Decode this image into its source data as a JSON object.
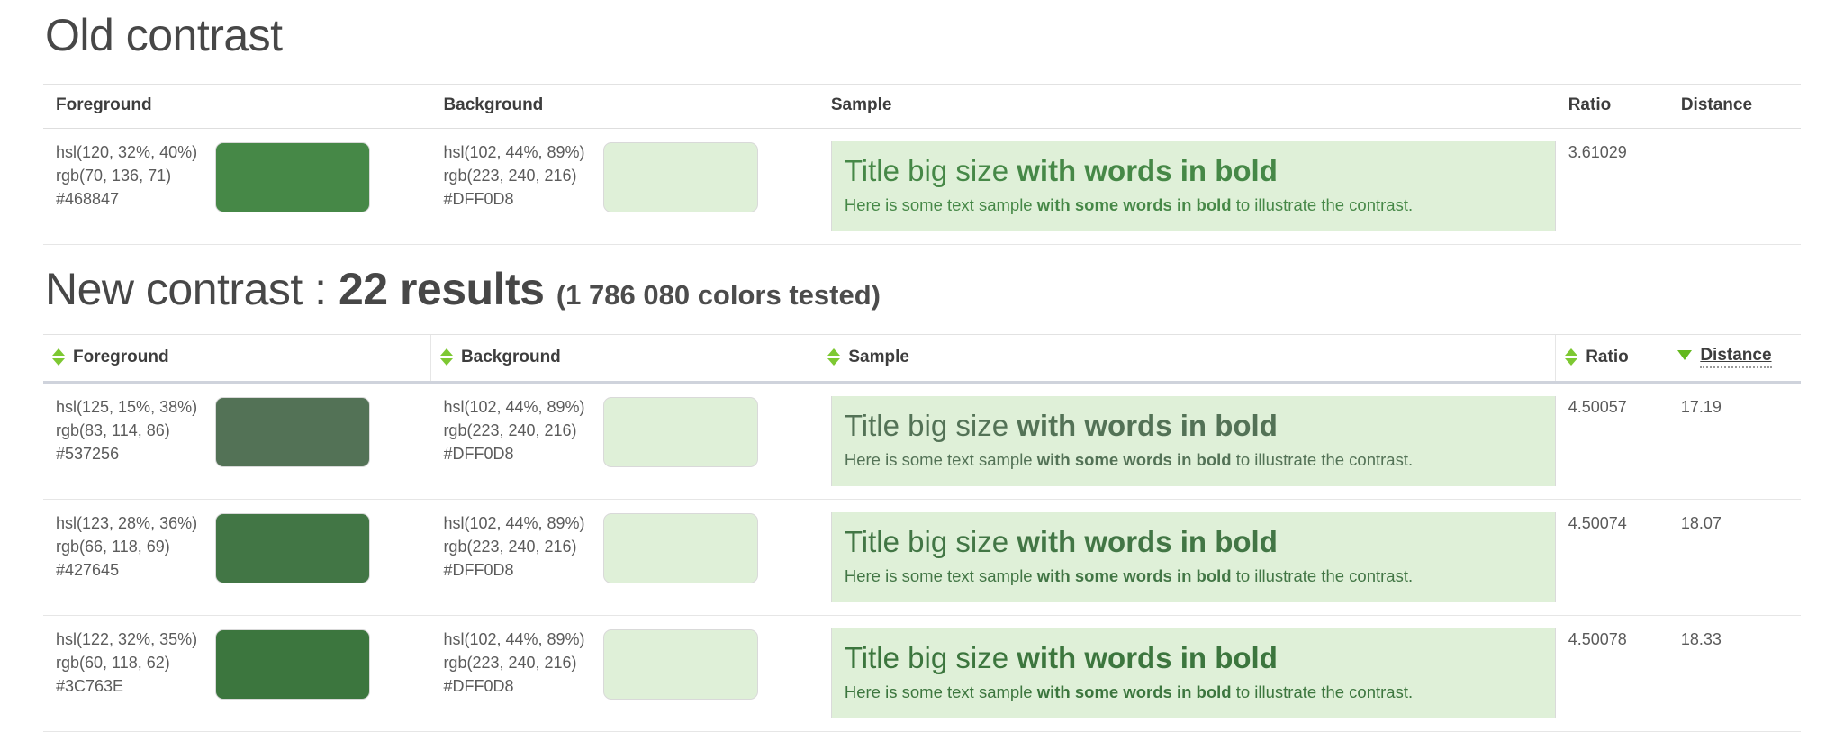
{
  "old_section": {
    "title": "Old contrast",
    "columns": [
      "Foreground",
      "Background",
      "Sample",
      "Ratio",
      "Distance"
    ],
    "rows": [
      {
        "fg": {
          "hsl": "hsl(120, 32%, 40%)",
          "rgb": "rgb(70, 136, 71)",
          "hex": "#468847"
        },
        "bg": {
          "hsl": "hsl(102, 44%, 89%)",
          "rgb": "rgb(223, 240, 216)",
          "hex": "#DFF0D8"
        },
        "sample": {
          "title_normal": "Title big size ",
          "title_bold": "with words in bold",
          "body_pre": "Here is some text sample ",
          "body_bold": "with some words in bold",
          "body_post": " to illustrate the contrast."
        },
        "ratio": "3.61029",
        "distance": ""
      }
    ]
  },
  "new_section": {
    "title_main": "New contrast : ",
    "title_count": "22 results",
    "title_sub": "(1 786 080 colors tested)",
    "columns": [
      {
        "label": "Foreground",
        "sort": "both"
      },
      {
        "label": "Background",
        "sort": "both"
      },
      {
        "label": "Sample",
        "sort": "both"
      },
      {
        "label": "Ratio",
        "sort": "both"
      },
      {
        "label": "Distance",
        "sort": "desc"
      }
    ],
    "rows": [
      {
        "fg": {
          "hsl": "hsl(125, 15%, 38%)",
          "rgb": "rgb(83, 114, 86)",
          "hex": "#537256"
        },
        "bg": {
          "hsl": "hsl(102, 44%, 89%)",
          "rgb": "rgb(223, 240, 216)",
          "hex": "#DFF0D8"
        },
        "sample": {
          "title_normal": "Title big size ",
          "title_bold": "with words in bold",
          "body_pre": "Here is some text sample ",
          "body_bold": "with some words in bold",
          "body_post": " to illustrate the contrast."
        },
        "ratio": "4.50057",
        "distance": "17.19"
      },
      {
        "fg": {
          "hsl": "hsl(123, 28%, 36%)",
          "rgb": "rgb(66, 118, 69)",
          "hex": "#427645"
        },
        "bg": {
          "hsl": "hsl(102, 44%, 89%)",
          "rgb": "rgb(223, 240, 216)",
          "hex": "#DFF0D8"
        },
        "sample": {
          "title_normal": "Title big size ",
          "title_bold": "with words in bold",
          "body_pre": "Here is some text sample ",
          "body_bold": "with some words in bold",
          "body_post": " to illustrate the contrast."
        },
        "ratio": "4.50074",
        "distance": "18.07"
      },
      {
        "fg": {
          "hsl": "hsl(122, 32%, 35%)",
          "rgb": "rgb(60, 118, 62)",
          "hex": "#3C763E"
        },
        "bg": {
          "hsl": "hsl(102, 44%, 89%)",
          "rgb": "rgb(223, 240, 216)",
          "hex": "#DFF0D8"
        },
        "sample": {
          "title_normal": "Title big size ",
          "title_bold": "with words in bold",
          "body_pre": "Here is some text sample ",
          "body_bold": "with some words in bold",
          "body_post": " to illustrate the contrast."
        },
        "ratio": "4.50078",
        "distance": "18.33"
      }
    ]
  },
  "colors": {
    "sort_icon_green": "#7dc832",
    "sort_icon_active_green": "#63b81d",
    "heading_gray": "#474747",
    "text_gray": "#5b5b5b",
    "border_gray": "#e6e6e6"
  }
}
